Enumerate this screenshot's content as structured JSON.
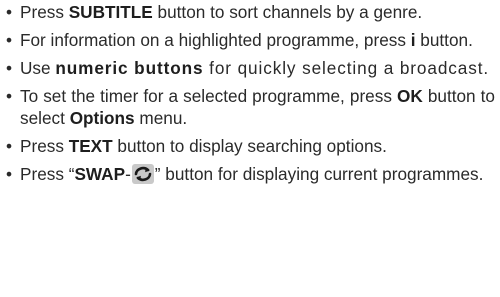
{
  "items": [
    {
      "bullet": "•",
      "pre1": "Press ",
      "b1": "SUBTITLE",
      "post1": " button to sort channels by a genre."
    },
    {
      "bullet": "•",
      "pre1": "For information on a highlighted programme, press ",
      "b1": "i",
      "post1": " button."
    },
    {
      "bullet": "•",
      "pre1": "Use ",
      "b1": "numeric buttons",
      "post1": " for quickly selecting a broadcast."
    },
    {
      "bullet": "•",
      "pre1": "To set the timer for a selected programme, press ",
      "b1": "OK",
      "mid": " button to select ",
      "b2": "Options",
      "post1": " menu."
    },
    {
      "bullet": "•",
      "pre1": "Press ",
      "b1": "TEXT",
      "post1": " button to display searching options."
    },
    {
      "bullet": "•",
      "pre1": "Press “",
      "b1": "SWAP",
      "dash": "-",
      "icon": "swap-arrows-icon",
      "post1": "” button for displaying current programmes."
    }
  ]
}
